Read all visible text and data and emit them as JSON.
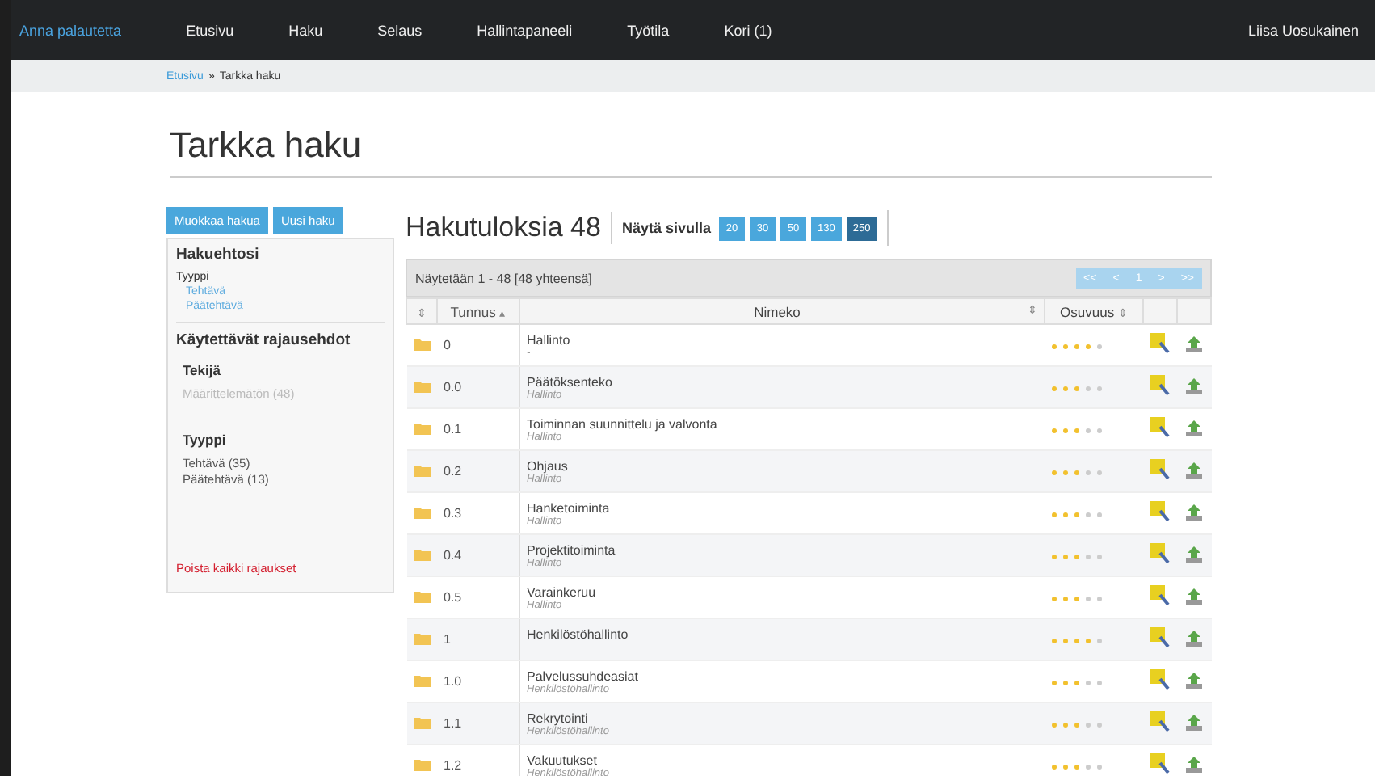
{
  "navbar": {
    "feedback": "Anna palautetta",
    "items": [
      {
        "label": "Etusivu"
      },
      {
        "label": "Haku"
      },
      {
        "label": "Selaus"
      },
      {
        "label": "Hallintapaneeli"
      },
      {
        "label": "Työtila"
      },
      {
        "label": "Kori (1)"
      }
    ],
    "user": "Liisa Uosukainen"
  },
  "breadcrumb": {
    "link": "Etusivu",
    "separator": "»",
    "current": "Tarkka haku"
  },
  "title": "Tarkka haku",
  "sidebar": {
    "buttons": [
      "Muokkaa hakua",
      "Uusi haku"
    ],
    "criteria_title": "Hakuehtosi",
    "criteria_label": "Tyyppi",
    "criteria_values": [
      "Tehtävä",
      "Päätehtävä"
    ],
    "facets_title": "Käytettävät rajausehdot",
    "facets": [
      {
        "title": "Tekijä",
        "items": [
          {
            "label": "Määrittelemätön (48)",
            "disabled": true
          }
        ]
      },
      {
        "title": "Tyyppi",
        "items": [
          {
            "label": "Tehtävä (35)",
            "disabled": false
          },
          {
            "label": "Päätehtävä (13)",
            "disabled": false
          }
        ]
      }
    ],
    "clear": "Poista kaikki rajaukset"
  },
  "results": {
    "heading": "Hakutuloksia 48",
    "per_page_label": "Näytä sivulla",
    "per_page": [
      {
        "label": "20",
        "selected": false
      },
      {
        "label": "30",
        "selected": false
      },
      {
        "label": "50",
        "selected": false
      },
      {
        "label": "130",
        "selected": false
      },
      {
        "label": "250",
        "selected": true
      }
    ],
    "showing": "Näytetään 1 - 48 [48 yhteensä]",
    "pager": [
      "<<",
      "<",
      "1",
      ">",
      ">>"
    ],
    "columns": [
      {
        "sort": "⇕"
      },
      {
        "label": "Tunnus",
        "sort": "▴"
      },
      {
        "label": "Nimeko",
        "sort": "⇕"
      },
      {
        "label": "Osuvuus",
        "sort": "⇕"
      }
    ],
    "rows": [
      {
        "code": "0",
        "name": "Hallinto",
        "parent": "-",
        "stars": 4
      },
      {
        "code": "0.0",
        "name": "Päätöksenteko",
        "parent": "Hallinto",
        "stars": 3
      },
      {
        "code": "0.1",
        "name": "Toiminnan suunnittelu ja valvonta",
        "parent": "Hallinto",
        "stars": 3
      },
      {
        "code": "0.2",
        "name": "Ohjaus",
        "parent": "Hallinto",
        "stars": 3
      },
      {
        "code": "0.3",
        "name": "Hanketoiminta",
        "parent": "Hallinto",
        "stars": 3
      },
      {
        "code": "0.4",
        "name": "Projektitoiminta",
        "parent": "Hallinto",
        "stars": 3
      },
      {
        "code": "0.5",
        "name": "Varainkeruu",
        "parent": "Hallinto",
        "stars": 3
      },
      {
        "code": "1",
        "name": "Henkilöstöhallinto",
        "parent": "-",
        "stars": 4
      },
      {
        "code": "1.0",
        "name": "Palvelussuhdeasiat",
        "parent": "Henkilöstöhallinto",
        "stars": 3
      },
      {
        "code": "1.1",
        "name": "Rekrytointi",
        "parent": "Henkilöstöhallinto",
        "stars": 3
      },
      {
        "code": "1.2",
        "name": "Vakuutukset",
        "parent": "Henkilöstöhallinto",
        "stars": 3
      }
    ]
  }
}
